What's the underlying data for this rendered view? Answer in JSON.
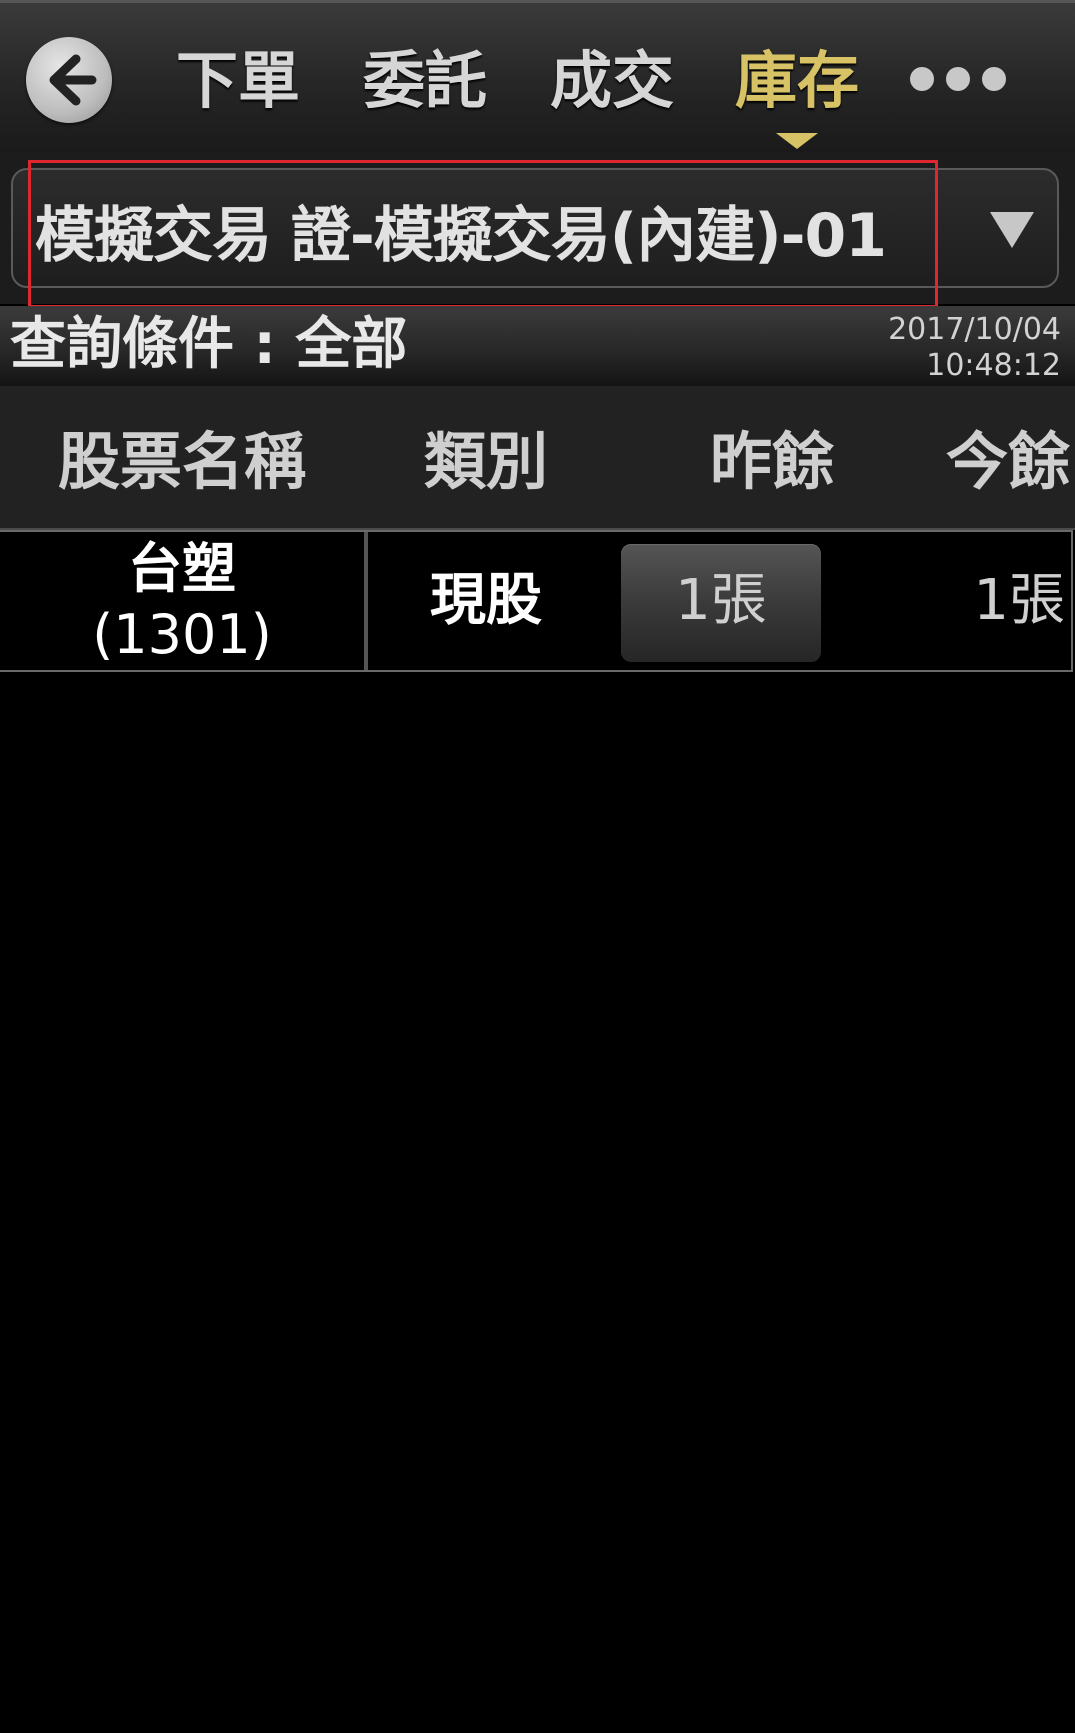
{
  "nav": {
    "tabs": [
      {
        "label": "下單",
        "active": false
      },
      {
        "label": "委託",
        "active": false
      },
      {
        "label": "成交",
        "active": false
      },
      {
        "label": "庫存",
        "active": true
      }
    ],
    "back_icon": "back-arrow-icon",
    "more_icon": "more-dots-icon",
    "active_color": "#d8c266"
  },
  "account": {
    "selected": "模擬交易 證-模擬交易(內建)-01",
    "dropdown_icon": "triangle-down-icon",
    "highlight_color": "#e0262e"
  },
  "query": {
    "label": "查詢條件 : 全部",
    "date": "2017/10/04",
    "time": "10:48:12"
  },
  "table": {
    "headers": [
      "股票名稱",
      "類別",
      "昨餘",
      "今餘"
    ],
    "rows": [
      {
        "name": "台塑",
        "code": "(1301)",
        "type": "現股",
        "yesterday": "1張",
        "today": "1張"
      }
    ]
  }
}
